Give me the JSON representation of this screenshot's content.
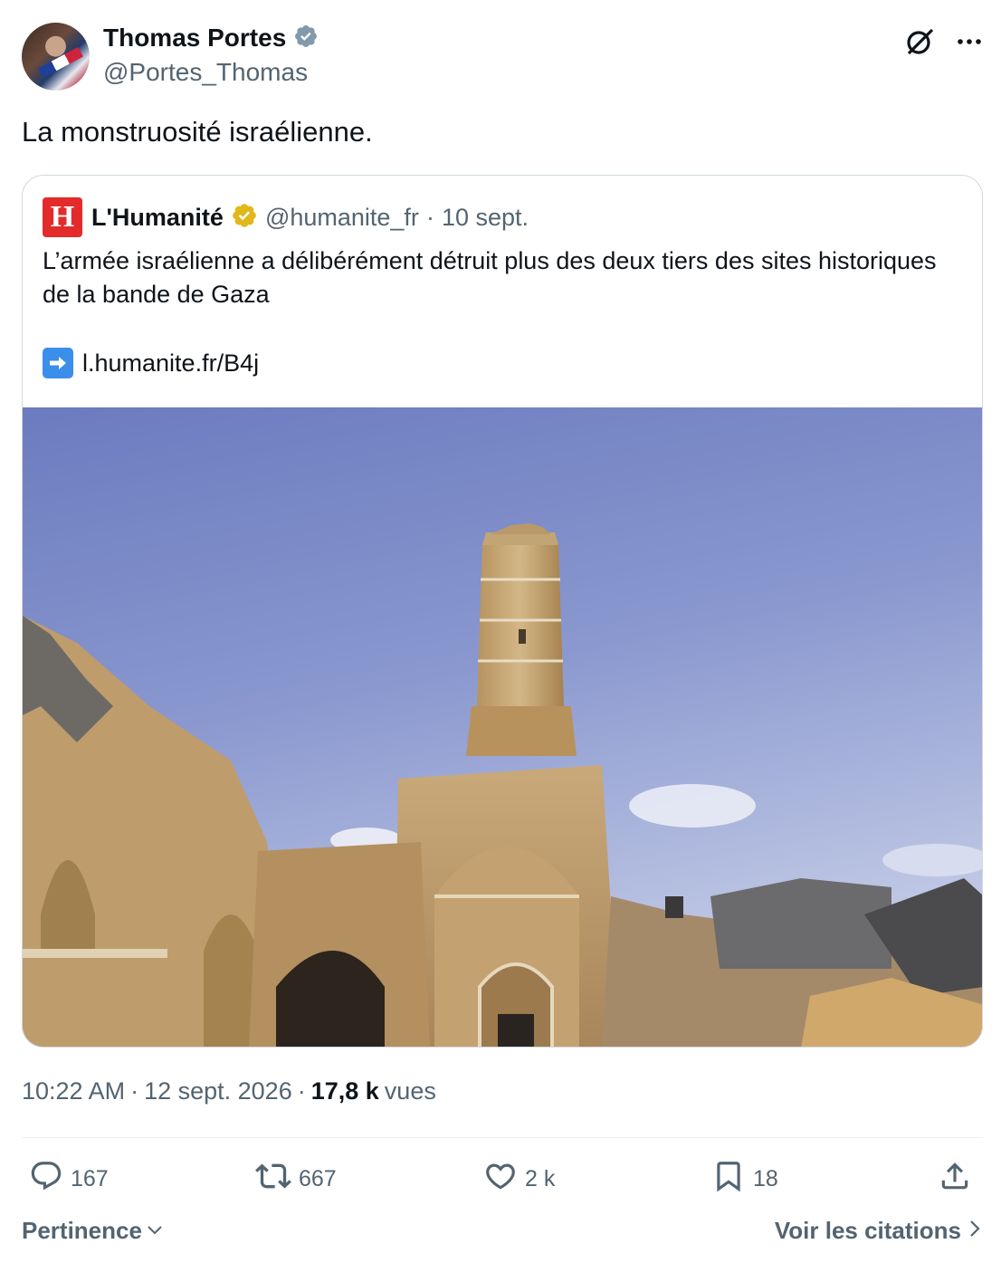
{
  "author": {
    "display_name": "Thomas Portes",
    "handle": "@Portes_Thomas",
    "verified_color": "#829aab"
  },
  "tweet": {
    "text": "La monstruosité israélienne."
  },
  "quoted": {
    "logo_letter": "H",
    "logo_color": "#e32b2b",
    "display_name": "L'Humanité",
    "verified_color": "#e2b719",
    "handle": "@humanite_fr",
    "separator": "·",
    "date": "10 sept.",
    "text": "L’armée israélienne a délibérément détruit plus des deux tiers des sites historiques de la bande de Gaza",
    "link_text": "l.humanite.fr/B4j",
    "image_icon": "mosque-ruins-photo"
  },
  "meta": {
    "time": "10:22 AM",
    "sep1": "·",
    "date": "12 sept. 2026",
    "sep2": "·",
    "views_count": "17,8 k",
    "views_label": "vues"
  },
  "actions": {
    "replies": "167",
    "reposts": "667",
    "likes": "2 k",
    "bookmarks": "18"
  },
  "footer": {
    "sort_label": "Pertinence",
    "citations_label": "Voir les citations"
  },
  "colors": {
    "text_primary": "#0f1419",
    "text_secondary": "#536471",
    "border": "#cfd9de"
  }
}
